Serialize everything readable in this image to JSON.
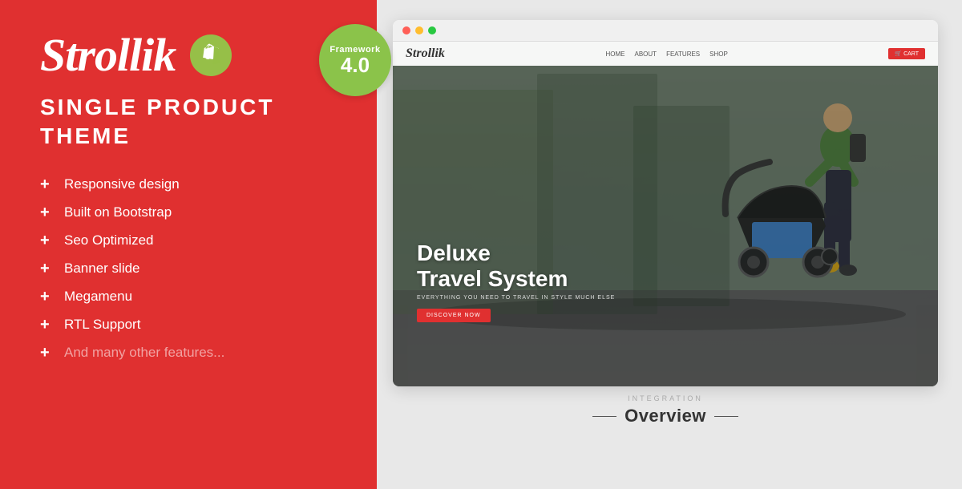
{
  "left": {
    "brand": "Strollik",
    "tagline": "SINGLE PRODUCT THEME",
    "shopify_icon_label": "shopify-icon",
    "features": [
      {
        "text": "Responsive design",
        "muted": false
      },
      {
        "text": "Built on Bootstrap",
        "muted": false
      },
      {
        "text": "Seo Optimized",
        "muted": false
      },
      {
        "text": "Banner slide",
        "muted": false
      },
      {
        "text": "Megamenu",
        "muted": false
      },
      {
        "text": "RTL Support",
        "muted": false
      },
      {
        "text": "And many other features...",
        "muted": true
      }
    ],
    "plus_symbol": "+",
    "bg_color": "#e03030"
  },
  "framework_badge": {
    "label": "Framework",
    "version": "4.0",
    "bg_color": "#8bc34a"
  },
  "browser": {
    "dots": [
      "red",
      "yellow",
      "green"
    ],
    "site": {
      "brand": "Strollik",
      "nav_links": [
        "HOME",
        "ABOUT",
        "FEATURES",
        "SHOP"
      ],
      "cart_label": "🛒 CART",
      "hero_title": "Deluxe\nTravel System",
      "hero_subtitle": "EVERYTHING YOU NEED TO TRAVEL IN STYLE MUCH ELSE",
      "cta_label": "DISCOVER NOW"
    }
  },
  "overview": {
    "integration_label": "INTEGRATION",
    "title": "Overview"
  }
}
